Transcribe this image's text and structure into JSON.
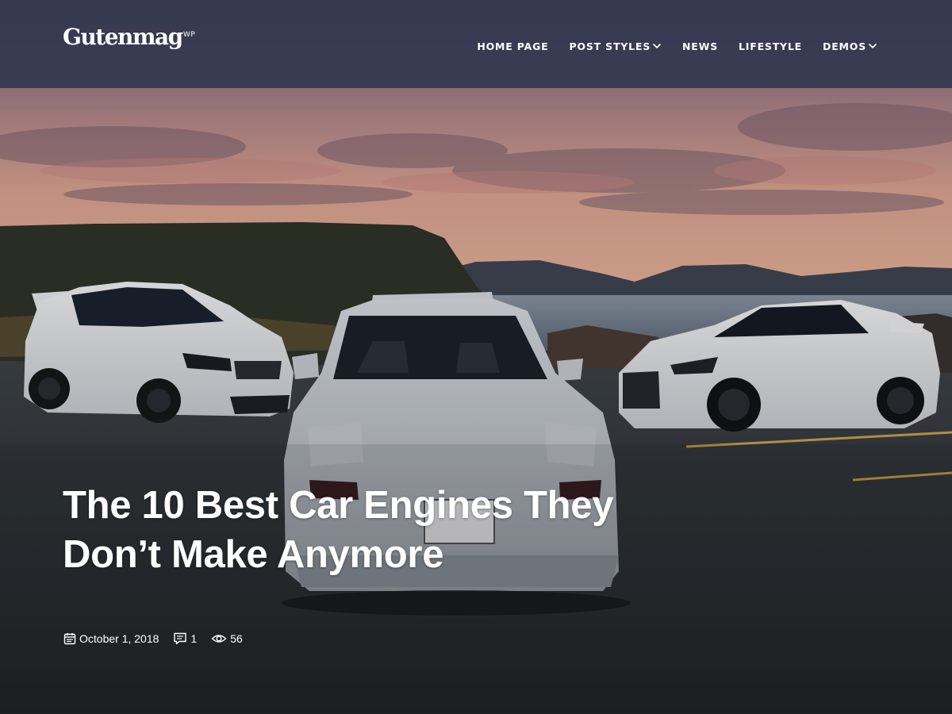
{
  "site": {
    "logo": "Gutenmag",
    "logo_sup": "WP"
  },
  "nav": {
    "items": [
      {
        "label": "HOME PAGE",
        "has_dropdown": false
      },
      {
        "label": "POST STYLES",
        "has_dropdown": true
      },
      {
        "label": "NEWS",
        "has_dropdown": false
      },
      {
        "label": "LIFESTYLE",
        "has_dropdown": false
      },
      {
        "label": "DEMOS",
        "has_dropdown": true
      }
    ]
  },
  "hero": {
    "image": "three white sports cars parked on an asphalt lot by the sea at sunset",
    "post": {
      "title": "The 10 Best Car Engines They Don’t Make Anymore",
      "date": "October 1, 2018",
      "comments": "1",
      "views": "56"
    }
  },
  "icons": {
    "calendar": "calendar-icon",
    "comments": "comment-icon",
    "views": "eye-icon",
    "dropdown": "chevron-down-icon"
  },
  "colors": {
    "header_bg": "#343850",
    "text": "#ffffff"
  }
}
